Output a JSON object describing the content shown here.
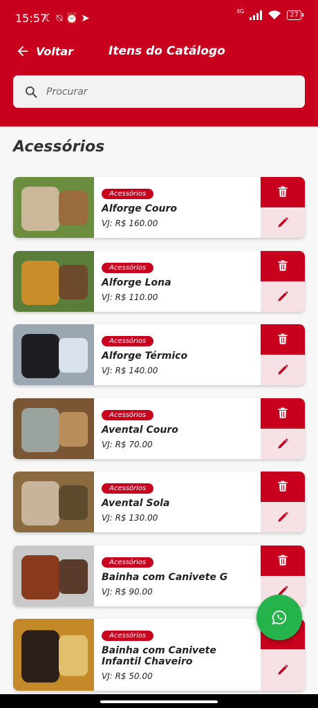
{
  "status_bar": {
    "time": "15:57",
    "network": "4G",
    "battery": "27"
  },
  "header": {
    "back_label": "Voltar",
    "title": "Itens do Catálogo"
  },
  "search": {
    "placeholder": "Procurar"
  },
  "section": {
    "title": "Acessórios"
  },
  "items": [
    {
      "category": "Acessórios",
      "name": "Alforge Couro",
      "price": "VJ: R$ 160.00",
      "thumb_colors": [
        "#6b8d3e",
        "#cbb89a",
        "#9a6b3c"
      ]
    },
    {
      "category": "Acessórios",
      "name": "Alforge Lona",
      "price": "VJ: R$ 110.00",
      "thumb_colors": [
        "#5a7d3a",
        "#c98e2a",
        "#6e4a2c"
      ]
    },
    {
      "category": "Acessórios",
      "name": "Alforge Térmico",
      "price": "VJ: R$ 140.00",
      "thumb_colors": [
        "#9aa7b3",
        "#1e1e22",
        "#d9e2ea"
      ]
    },
    {
      "category": "Acessórios",
      "name": "Avental Couro",
      "price": "VJ: R$ 70.00",
      "thumb_colors": [
        "#7a5634",
        "#9aa39d",
        "#b98e5a"
      ]
    },
    {
      "category": "Acessórios",
      "name": "Avental Sola",
      "price": "VJ: R$ 130.00",
      "thumb_colors": [
        "#8a6a3e",
        "#c8b49a",
        "#5e4a2c"
      ]
    },
    {
      "category": "Acessórios",
      "name": "Bainha com Canivete G",
      "price": "VJ: R$ 90.00",
      "thumb_colors": [
        "#c9c9c9",
        "#8a3a1c",
        "#5a3a2a"
      ]
    },
    {
      "category": "Acessórios",
      "name": "Bainha com Canivete Infantil Chaveiro",
      "price": "VJ: R$ 50.00",
      "thumb_colors": [
        "#c48a2a",
        "#2c1e18",
        "#e0c06a"
      ]
    }
  ],
  "colors": {
    "primary": "#c8001e",
    "edit_bg": "#f6e1e4",
    "whatsapp": "#25b34c"
  },
  "icons": {
    "back": "arrow-left-icon",
    "search": "search-icon",
    "delete": "trash-icon",
    "edit": "pencil-icon",
    "fab": "whatsapp-icon"
  }
}
